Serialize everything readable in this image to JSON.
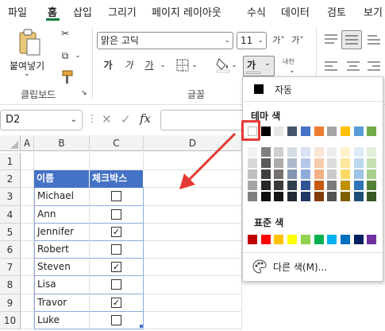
{
  "menu": {
    "tabs": [
      "파일",
      "홈",
      "삽입",
      "그리기",
      "페이지 레이아웃",
      "수식",
      "데이터",
      "검토",
      "보기"
    ],
    "active": "홈"
  },
  "ribbon": {
    "paste_label": "붙여넣기",
    "clipboard_group": "클립보드",
    "font_group": "글꼴",
    "font_name": "맑은 고딕",
    "font_size": "11",
    "grow_font": "가˄",
    "shrink_font": "가˅",
    "bold": "가",
    "italic": "가",
    "underline": "가",
    "font_color_button": "가",
    "phonetic": "내천"
  },
  "formula_bar": {
    "name_box": "D2",
    "cancel": "✕",
    "confirm": "✓",
    "fx": "fx"
  },
  "sheet": {
    "columns": [
      "A",
      "B",
      "C",
      "D"
    ],
    "rows": [
      "1",
      "2",
      "3",
      "4",
      "5",
      "6",
      "7",
      "8",
      "9",
      "10"
    ],
    "table_headers": [
      "이름",
      "체크박스"
    ],
    "records": [
      {
        "name": "Michael",
        "checked": false
      },
      {
        "name": "Ann",
        "checked": false
      },
      {
        "name": "Jennifer",
        "checked": true
      },
      {
        "name": "Robert",
        "checked": false
      },
      {
        "name": "Steven",
        "checked": true
      },
      {
        "name": "Lisa",
        "checked": false
      },
      {
        "name": "Travor",
        "checked": true
      },
      {
        "name": "Luke",
        "checked": false
      }
    ]
  },
  "color_menu": {
    "automatic": "자동",
    "theme_title": "테마 색",
    "standard_title": "표준 색",
    "more_colors": "다른 색(M)...",
    "theme_top": [
      "#ffffff",
      "#000000",
      "#e7e6e6",
      "#44546a",
      "#4472c4",
      "#ed7d31",
      "#a5a5a5",
      "#ffc000",
      "#5b9bd5",
      "#70ad47"
    ],
    "theme_shades": [
      [
        "#f2f2f2",
        "#7f7f7f",
        "#d0cece",
        "#d6dce4",
        "#d9e2f3",
        "#fbe5d5",
        "#ededed",
        "#fff2cc",
        "#deebf6",
        "#e2efd9"
      ],
      [
        "#d8d8d8",
        "#595959",
        "#aeabab",
        "#adb9ca",
        "#b4c6e7",
        "#f7cbac",
        "#dbdbdb",
        "#fee599",
        "#bdd7ee",
        "#c5e0b3"
      ],
      [
        "#bfbfbf",
        "#3f3f3f",
        "#757070",
        "#8496b0",
        "#8eaadb",
        "#f4b183",
        "#c9c9c9",
        "#ffd965",
        "#9dc3e6",
        "#a8d08d"
      ],
      [
        "#a5a5a5",
        "#262626",
        "#3a3838",
        "#323f4f",
        "#2f5496",
        "#c55a11",
        "#7b7b7b",
        "#bf9000",
        "#2e75b5",
        "#538135"
      ],
      [
        "#7f7f7f",
        "#0c0c0c",
        "#171616",
        "#222a35",
        "#1f3864",
        "#833c0b",
        "#525252",
        "#7f6000",
        "#1e4e79",
        "#375623"
      ]
    ],
    "standard": [
      "#c00000",
      "#ff0000",
      "#ffc000",
      "#ffff00",
      "#92d050",
      "#00b050",
      "#00b0f0",
      "#0070c0",
      "#002060",
      "#7030a0"
    ]
  },
  "colors": {
    "accent_green": "#107c41",
    "table_header": "#4472c4",
    "highlight_red": "#e53935"
  }
}
